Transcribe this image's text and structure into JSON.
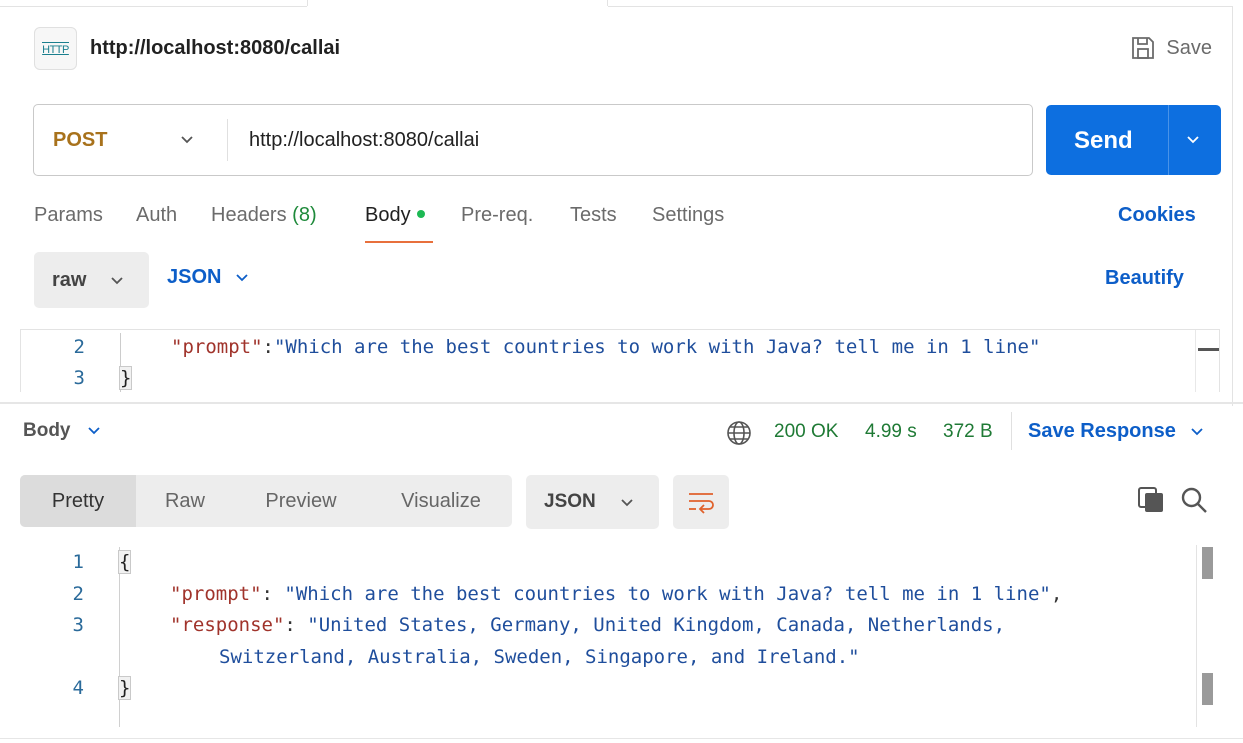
{
  "request": {
    "name": "http://localhost:8080/callai",
    "icon_text": "HTTP",
    "save_label": "Save",
    "method": "POST",
    "url": "http://localhost:8080/callai",
    "send_label": "Send"
  },
  "request_tabs": {
    "params": "Params",
    "auth": "Auth",
    "headers": "Headers",
    "headers_count": "(8)",
    "body": "Body",
    "prereq": "Pre-req.",
    "tests": "Tests",
    "settings": "Settings",
    "cookies": "Cookies"
  },
  "body_mode": {
    "mode": "raw",
    "language": "JSON",
    "beautify": "Beautify"
  },
  "request_editor": {
    "lines": [
      {
        "num": "2",
        "key": "\"prompt\"",
        "sep": ":",
        "value": "\"Which are the best countries to work with Java? tell me in 1 line\""
      },
      {
        "num": "3",
        "brace": "}"
      }
    ]
  },
  "response": {
    "body_label": "Body",
    "status": "200 OK",
    "time": "4.99 s",
    "size": "372 B",
    "save_response": "Save Response",
    "view_tabs": [
      "Pretty",
      "Raw",
      "Preview",
      "Visualize"
    ],
    "format": "JSON",
    "lines": {
      "l1_num": "1",
      "l1": "{",
      "l2_num": "2",
      "l2_key": "\"prompt\"",
      "l2_sep": ": ",
      "l2_value": "\"Which are the best countries to work with Java? tell me in 1 line\"",
      "l2_end": ",",
      "l3_num": "3",
      "l3_key": "\"response\"",
      "l3_sep": ": ",
      "l3_value": "\"United States, Germany, United Kingdom, Canada, Netherlands,",
      "l3_value_wrap": "Switzerland, Australia, Sweden, Singapore, and Ireland.\"",
      "l4_num": "4",
      "l4": "}"
    }
  },
  "colors": {
    "accent": "#0d6fe0",
    "method": "#a8721c",
    "status": "#1f7a35",
    "link": "#0d5ec8",
    "tab_underline": "#e8703c"
  }
}
